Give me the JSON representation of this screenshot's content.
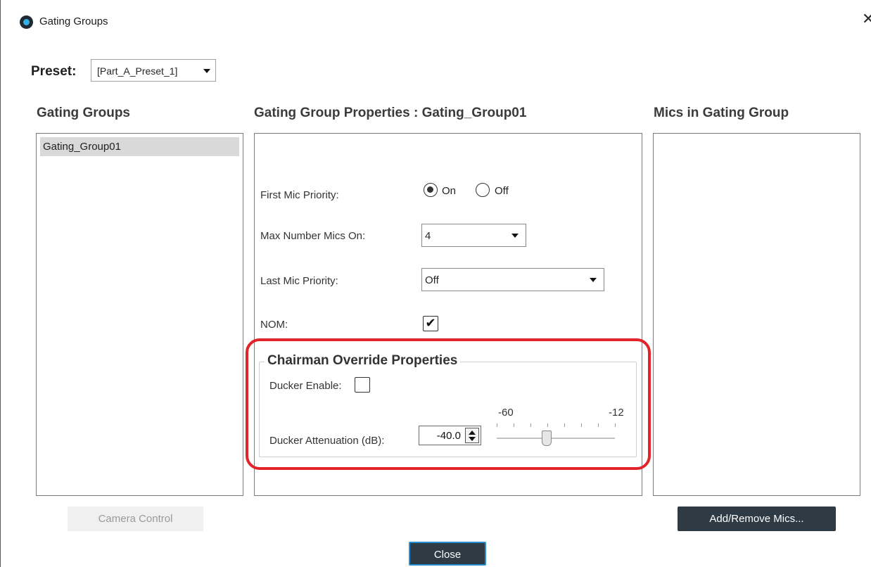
{
  "window": {
    "title": "Gating Groups",
    "close_glyph": "✕"
  },
  "preset": {
    "label": "Preset:",
    "selected": "[Part_A_Preset_1]"
  },
  "columns": {
    "gating_groups": "Gating Groups",
    "properties": "Gating Group Properties : Gating_Group01",
    "mics": "Mics in Gating Group"
  },
  "gating_groups_list": [
    "Gating_Group01"
  ],
  "properties": {
    "first_mic_priority": {
      "label": "First Mic Priority:",
      "on_label": "On",
      "off_label": "Off",
      "value": "On"
    },
    "max_mics": {
      "label": "Max Number Mics On:",
      "value": "4"
    },
    "last_mic_priority": {
      "label": "Last Mic Priority:",
      "value": "Off"
    },
    "nom": {
      "label": "NOM:",
      "checked": true,
      "check_glyph": "✔"
    }
  },
  "chairman": {
    "title": "Chairman Override Properties",
    "ducker_enable_label": "Ducker Enable:",
    "ducker_enable_checked": false,
    "attenuation_label": "Ducker Attenuation (dB):",
    "attenuation_value": "-40.0",
    "scale_min": "-60",
    "scale_max": "-12",
    "slider_fraction": 0.42
  },
  "buttons": {
    "camera_control": "Camera Control",
    "add_remove_mics": "Add/Remove Mics...",
    "close": "Close"
  },
  "colors": {
    "highlight": "#e2232a",
    "button_dark": "#2e3b45",
    "focus_border": "#2a8fd0"
  }
}
